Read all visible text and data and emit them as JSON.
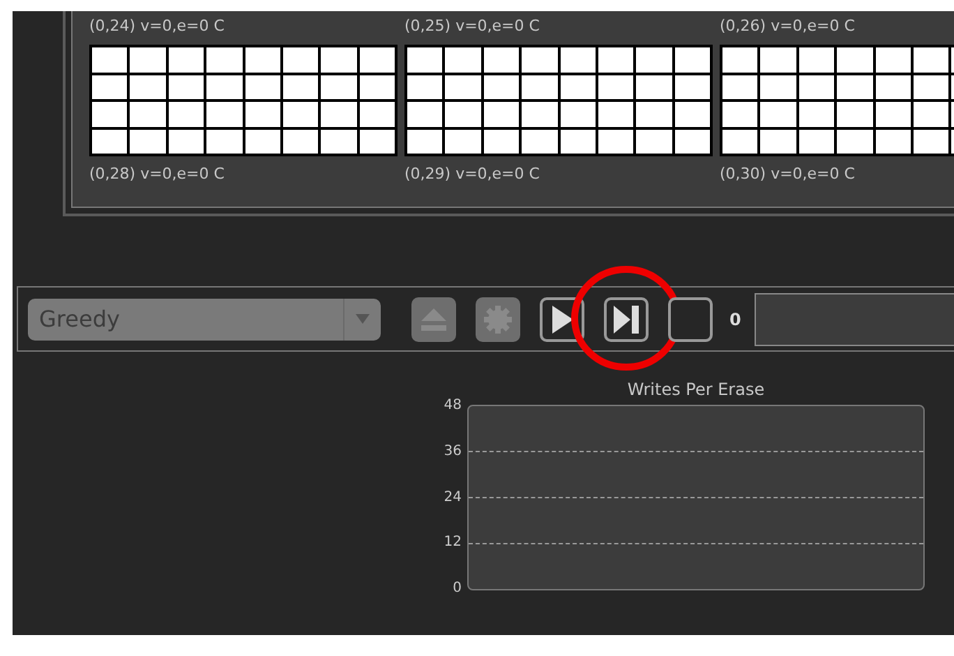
{
  "blocks": [
    {
      "label": "(0,24) v=0,e=0 C"
    },
    {
      "label": "(0,25) v=0,e=0 C"
    },
    {
      "label": "(0,26) v=0,e=0 C"
    }
  ],
  "next_labels": [
    "(0,28) v=0,e=0 C",
    "(0,29) v=0,e=0 C",
    "(0,30) v=0,e=0 C"
  ],
  "toolbar": {
    "strategy": {
      "value": "Greedy",
      "disabled": true
    },
    "buttons": [
      {
        "kind": "eject",
        "disabled": true,
        "highlighted": false
      },
      {
        "kind": "gear",
        "disabled": true,
        "highlighted": false
      },
      {
        "kind": "play",
        "disabled": false,
        "highlighted": false
      },
      {
        "kind": "step",
        "disabled": false,
        "highlighted": true
      },
      {
        "kind": "stop",
        "disabled": false,
        "highlighted": false
      }
    ],
    "counter": "0"
  },
  "chart": {
    "title": "Writes Per Erase",
    "y_labels": [
      "48",
      "36",
      "24",
      "12",
      "0"
    ]
  }
}
